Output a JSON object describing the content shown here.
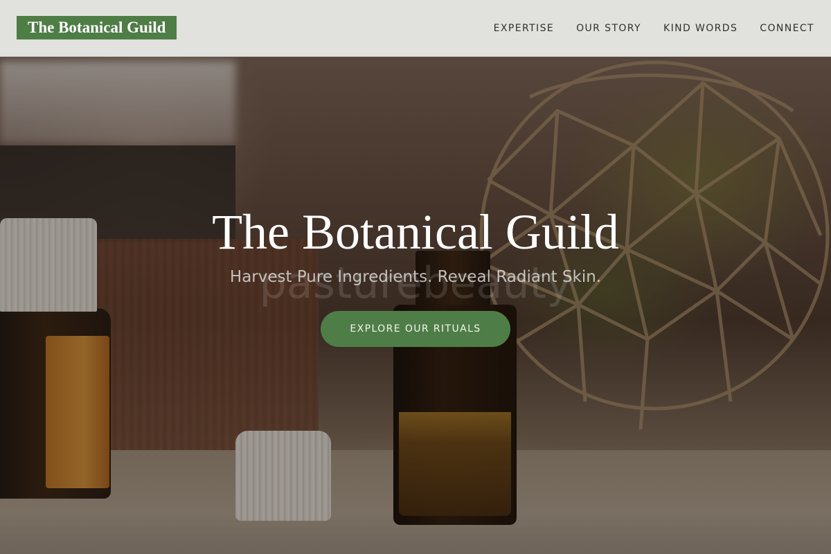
{
  "header": {
    "brand": "The Botanical Guild",
    "nav": [
      {
        "label": "EXPERTISE"
      },
      {
        "label": "OUR STORY"
      },
      {
        "label": "KIND WORDS"
      },
      {
        "label": "CONNECT"
      }
    ]
  },
  "hero": {
    "title": "The Botanical Guild",
    "subtitle": "Harvest Pure Ingredients. Reveal Radiant Skin.",
    "cta_label": "EXPLORE OUR RITUALS",
    "watermark": "pasturebeauty"
  },
  "colors": {
    "brand_green": "#4e7d46",
    "header_bg": "#eceeea",
    "nav_text": "#2f2f2f"
  }
}
